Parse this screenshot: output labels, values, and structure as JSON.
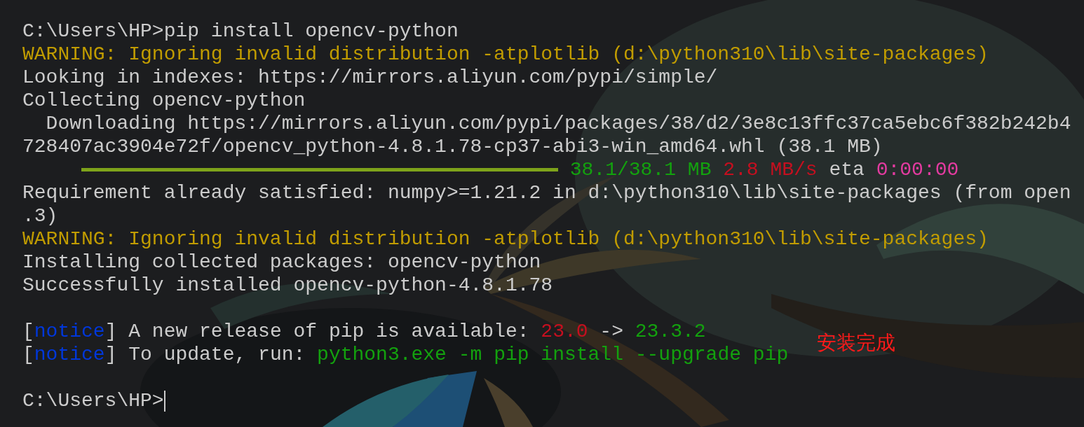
{
  "terminal": {
    "lines": [
      {
        "kind": "text",
        "segments": [
          {
            "kind": "plain",
            "text": "C:\\Users\\HP>pip install opencv-python"
          }
        ]
      },
      {
        "kind": "text",
        "segments": [
          {
            "kind": "warning",
            "text": "WARNING: Ignoring invalid distribution -atplotlib (d:\\python310\\lib\\site-packages)"
          }
        ]
      },
      {
        "kind": "text",
        "segments": [
          {
            "kind": "plain",
            "text": "Looking in indexes: https://mirrors.aliyun.com/pypi/simple/"
          }
        ]
      },
      {
        "kind": "text",
        "segments": [
          {
            "kind": "plain",
            "text": "Collecting opencv-python"
          }
        ]
      },
      {
        "kind": "text",
        "segments": [
          {
            "kind": "plain",
            "text": "  Downloading https://mirrors.aliyun.com/pypi/packages/38/d2/3e8c13ffc37ca5ebc6f382b242b4"
          }
        ]
      },
      {
        "kind": "text",
        "segments": [
          {
            "kind": "plain",
            "text": "728407ac3904e72f/opencv_python-4.8.1.78-cp37-abi3-win_amd64.whl (38.1 MB)"
          }
        ]
      },
      {
        "kind": "progress",
        "level": 1,
        "segments": [
          {
            "kind": "green",
            "text": "38.1/38.1 MB"
          },
          {
            "kind": "red",
            "text": "2.8 MB/s"
          },
          {
            "kind": "plain",
            "text": "eta"
          },
          {
            "kind": "magenta",
            "text": "0:00:00"
          }
        ]
      },
      {
        "kind": "text",
        "segments": [
          {
            "kind": "plain",
            "text": "Requirement already satisfied: numpy>=1.21.2 in d:\\python310\\lib\\site-packages (from open"
          }
        ]
      },
      {
        "kind": "text",
        "segments": [
          {
            "kind": "plain",
            "text": ".3)"
          }
        ]
      },
      {
        "kind": "text",
        "segments": [
          {
            "kind": "warning",
            "text": "WARNING: Ignoring invalid distribution -atplotlib (d:\\python310\\lib\\site-packages)"
          }
        ]
      },
      {
        "kind": "text",
        "segments": [
          {
            "kind": "plain",
            "text": "Installing collected packages: opencv-python"
          }
        ]
      },
      {
        "kind": "text",
        "segments": [
          {
            "kind": "plain",
            "text": "Successfully installed opencv-python-4.8.1.78"
          }
        ]
      },
      {
        "kind": "blank"
      },
      {
        "kind": "text",
        "segments": [
          {
            "kind": "plain",
            "text": "["
          },
          {
            "kind": "blue",
            "text": "notice"
          },
          {
            "kind": "plain",
            "text": "] A new release of pip is available:"
          },
          {
            "kind": "red",
            "text": "23.0"
          },
          {
            "kind": "plain",
            "text": "->"
          },
          {
            "kind": "green",
            "text": "23.3.2"
          }
        ]
      },
      {
        "kind": "text",
        "segments": [
          {
            "kind": "plain",
            "text": "["
          },
          {
            "kind": "blue",
            "text": "notice"
          },
          {
            "kind": "plain",
            "text": "] To update, run:"
          },
          {
            "kind": "green",
            "text": "python3.exe -m pip install --upgrade pip"
          }
        ]
      },
      {
        "kind": "blank"
      },
      {
        "kind": "prompt",
        "segments": [
          {
            "kind": "plain",
            "text": "C:\\Users\\HP>"
          }
        ]
      }
    ]
  },
  "annotation": {
    "text": "安装完成"
  }
}
